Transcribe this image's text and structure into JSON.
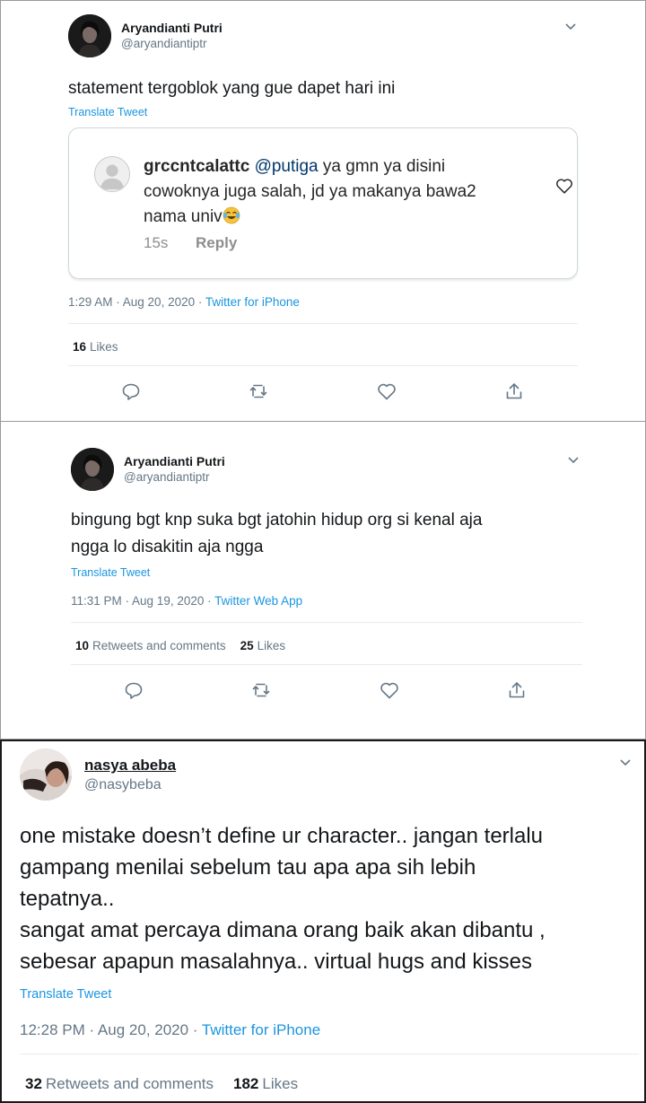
{
  "tweet1": {
    "display_name": "Aryandianti Putri",
    "handle": "@aryandiantiptr",
    "text": "statement tergoblok yang gue dapet hari ini",
    "translate_label": "Translate Tweet",
    "quoted_comment": {
      "username": "grccntcalattc",
      "mention": "@putiga",
      "text": "ya gmn ya disini cowoknya juga salah, jd ya makanya bawa2 nama univ",
      "emoji": "face-with-tears-of-joy-emoji",
      "time": "15s",
      "reply_label": "Reply"
    },
    "timestamp": "1:29 AM · Aug 20, 2020 · ",
    "source": "Twitter for iPhone",
    "likes_count": "16",
    "likes_label": "Likes"
  },
  "tweet2": {
    "display_name": "Aryandianti Putri",
    "handle": "@aryandiantiptr",
    "text_line1": "bingung bgt knp suka bgt jatohin hidup org si kenal aja",
    "text_line2": "ngga lo disakitin aja ngga",
    "translate_label": "Translate Tweet",
    "timestamp": "11:31 PM · Aug 19, 2020 · ",
    "source": "Twitter Web App",
    "retweets_count": "10",
    "retweets_label": "Retweets and comments",
    "likes_count": "25",
    "likes_label": "Likes"
  },
  "tweet3": {
    "display_name": "nasya abeba",
    "handle": "@nasybeba",
    "text_line1": "one mistake doesn’t define ur character.. jangan terlalu",
    "text_line2": "gampang menilai sebelum tau apa apa sih lebih",
    "text_line3": "tepatnya..",
    "text_line4": "sangat amat percaya dimana orang baik akan dibantu ,",
    "text_line5": "sebesar apapun masalahnya.. virtual hugs and kisses",
    "translate_label": "Translate Tweet",
    "timestamp": "12:28 PM · Aug 20, 2020 · ",
    "source": "Twitter for iPhone",
    "retweets_count": "32",
    "retweets_label": "Retweets and comments",
    "likes_count": "182",
    "likes_label": "Likes"
  },
  "icons": [
    "reply-icon",
    "retweet-icon",
    "like-icon",
    "share-icon",
    "chevron-down-icon"
  ],
  "colors": {
    "link": "#1b95e0",
    "muted": "#657786",
    "text": "#14171a"
  }
}
